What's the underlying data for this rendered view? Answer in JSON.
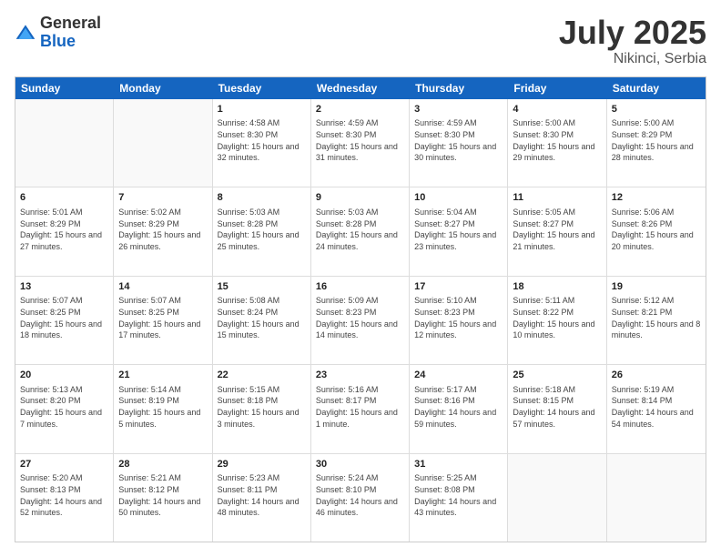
{
  "header": {
    "logo_general": "General",
    "logo_blue": "Blue",
    "title": "July 2025",
    "location": "Nikinci, Serbia"
  },
  "days_of_week": [
    "Sunday",
    "Monday",
    "Tuesday",
    "Wednesday",
    "Thursday",
    "Friday",
    "Saturday"
  ],
  "weeks": [
    [
      {
        "day": "",
        "sunrise": "",
        "sunset": "",
        "daylight": "",
        "empty": true
      },
      {
        "day": "",
        "sunrise": "",
        "sunset": "",
        "daylight": "",
        "empty": true
      },
      {
        "day": "1",
        "sunrise": "Sunrise: 4:58 AM",
        "sunset": "Sunset: 8:30 PM",
        "daylight": "Daylight: 15 hours and 32 minutes."
      },
      {
        "day": "2",
        "sunrise": "Sunrise: 4:59 AM",
        "sunset": "Sunset: 8:30 PM",
        "daylight": "Daylight: 15 hours and 31 minutes."
      },
      {
        "day": "3",
        "sunrise": "Sunrise: 4:59 AM",
        "sunset": "Sunset: 8:30 PM",
        "daylight": "Daylight: 15 hours and 30 minutes."
      },
      {
        "day": "4",
        "sunrise": "Sunrise: 5:00 AM",
        "sunset": "Sunset: 8:30 PM",
        "daylight": "Daylight: 15 hours and 29 minutes."
      },
      {
        "day": "5",
        "sunrise": "Sunrise: 5:00 AM",
        "sunset": "Sunset: 8:29 PM",
        "daylight": "Daylight: 15 hours and 28 minutes."
      }
    ],
    [
      {
        "day": "6",
        "sunrise": "Sunrise: 5:01 AM",
        "sunset": "Sunset: 8:29 PM",
        "daylight": "Daylight: 15 hours and 27 minutes."
      },
      {
        "day": "7",
        "sunrise": "Sunrise: 5:02 AM",
        "sunset": "Sunset: 8:29 PM",
        "daylight": "Daylight: 15 hours and 26 minutes."
      },
      {
        "day": "8",
        "sunrise": "Sunrise: 5:03 AM",
        "sunset": "Sunset: 8:28 PM",
        "daylight": "Daylight: 15 hours and 25 minutes."
      },
      {
        "day": "9",
        "sunrise": "Sunrise: 5:03 AM",
        "sunset": "Sunset: 8:28 PM",
        "daylight": "Daylight: 15 hours and 24 minutes."
      },
      {
        "day": "10",
        "sunrise": "Sunrise: 5:04 AM",
        "sunset": "Sunset: 8:27 PM",
        "daylight": "Daylight: 15 hours and 23 minutes."
      },
      {
        "day": "11",
        "sunrise": "Sunrise: 5:05 AM",
        "sunset": "Sunset: 8:27 PM",
        "daylight": "Daylight: 15 hours and 21 minutes."
      },
      {
        "day": "12",
        "sunrise": "Sunrise: 5:06 AM",
        "sunset": "Sunset: 8:26 PM",
        "daylight": "Daylight: 15 hours and 20 minutes."
      }
    ],
    [
      {
        "day": "13",
        "sunrise": "Sunrise: 5:07 AM",
        "sunset": "Sunset: 8:25 PM",
        "daylight": "Daylight: 15 hours and 18 minutes."
      },
      {
        "day": "14",
        "sunrise": "Sunrise: 5:07 AM",
        "sunset": "Sunset: 8:25 PM",
        "daylight": "Daylight: 15 hours and 17 minutes."
      },
      {
        "day": "15",
        "sunrise": "Sunrise: 5:08 AM",
        "sunset": "Sunset: 8:24 PM",
        "daylight": "Daylight: 15 hours and 15 minutes."
      },
      {
        "day": "16",
        "sunrise": "Sunrise: 5:09 AM",
        "sunset": "Sunset: 8:23 PM",
        "daylight": "Daylight: 15 hours and 14 minutes."
      },
      {
        "day": "17",
        "sunrise": "Sunrise: 5:10 AM",
        "sunset": "Sunset: 8:23 PM",
        "daylight": "Daylight: 15 hours and 12 minutes."
      },
      {
        "day": "18",
        "sunrise": "Sunrise: 5:11 AM",
        "sunset": "Sunset: 8:22 PM",
        "daylight": "Daylight: 15 hours and 10 minutes."
      },
      {
        "day": "19",
        "sunrise": "Sunrise: 5:12 AM",
        "sunset": "Sunset: 8:21 PM",
        "daylight": "Daylight: 15 hours and 8 minutes."
      }
    ],
    [
      {
        "day": "20",
        "sunrise": "Sunrise: 5:13 AM",
        "sunset": "Sunset: 8:20 PM",
        "daylight": "Daylight: 15 hours and 7 minutes."
      },
      {
        "day": "21",
        "sunrise": "Sunrise: 5:14 AM",
        "sunset": "Sunset: 8:19 PM",
        "daylight": "Daylight: 15 hours and 5 minutes."
      },
      {
        "day": "22",
        "sunrise": "Sunrise: 5:15 AM",
        "sunset": "Sunset: 8:18 PM",
        "daylight": "Daylight: 15 hours and 3 minutes."
      },
      {
        "day": "23",
        "sunrise": "Sunrise: 5:16 AM",
        "sunset": "Sunset: 8:17 PM",
        "daylight": "Daylight: 15 hours and 1 minute."
      },
      {
        "day": "24",
        "sunrise": "Sunrise: 5:17 AM",
        "sunset": "Sunset: 8:16 PM",
        "daylight": "Daylight: 14 hours and 59 minutes."
      },
      {
        "day": "25",
        "sunrise": "Sunrise: 5:18 AM",
        "sunset": "Sunset: 8:15 PM",
        "daylight": "Daylight: 14 hours and 57 minutes."
      },
      {
        "day": "26",
        "sunrise": "Sunrise: 5:19 AM",
        "sunset": "Sunset: 8:14 PM",
        "daylight": "Daylight: 14 hours and 54 minutes."
      }
    ],
    [
      {
        "day": "27",
        "sunrise": "Sunrise: 5:20 AM",
        "sunset": "Sunset: 8:13 PM",
        "daylight": "Daylight: 14 hours and 52 minutes."
      },
      {
        "day": "28",
        "sunrise": "Sunrise: 5:21 AM",
        "sunset": "Sunset: 8:12 PM",
        "daylight": "Daylight: 14 hours and 50 minutes."
      },
      {
        "day": "29",
        "sunrise": "Sunrise: 5:23 AM",
        "sunset": "Sunset: 8:11 PM",
        "daylight": "Daylight: 14 hours and 48 minutes."
      },
      {
        "day": "30",
        "sunrise": "Sunrise: 5:24 AM",
        "sunset": "Sunset: 8:10 PM",
        "daylight": "Daylight: 14 hours and 46 minutes."
      },
      {
        "day": "31",
        "sunrise": "Sunrise: 5:25 AM",
        "sunset": "Sunset: 8:08 PM",
        "daylight": "Daylight: 14 hours and 43 minutes."
      },
      {
        "day": "",
        "sunrise": "",
        "sunset": "",
        "daylight": "",
        "empty": true
      },
      {
        "day": "",
        "sunrise": "",
        "sunset": "",
        "daylight": "",
        "empty": true
      }
    ]
  ]
}
